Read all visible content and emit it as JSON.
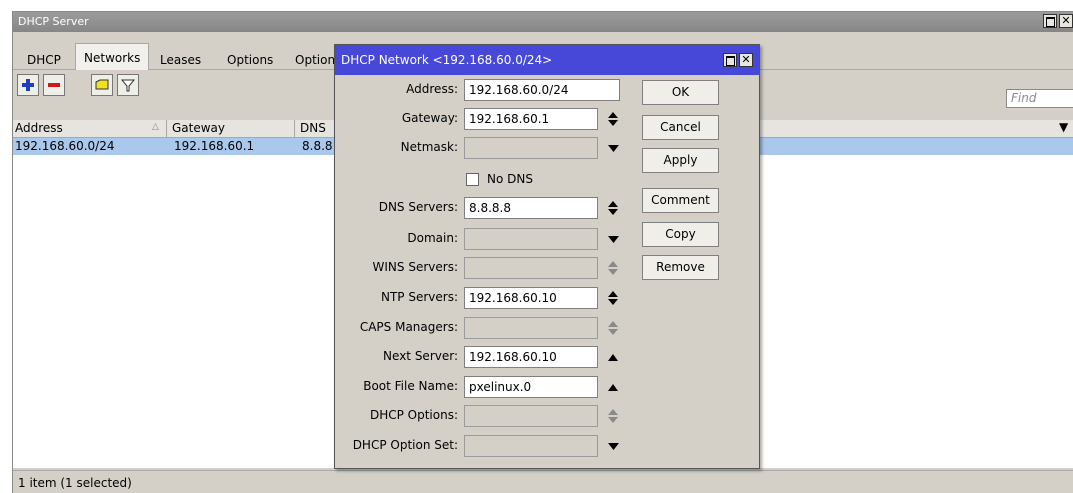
{
  "window": {
    "title": "DHCP Server",
    "tabs": [
      "DHCP",
      "Networks",
      "Leases",
      "Options",
      "Option"
    ],
    "active_tab": "Networks",
    "find_placeholder": "Find",
    "columns": [
      "Address",
      "Gateway",
      "DNS"
    ],
    "rows": [
      {
        "address": "192.168.60.0/24",
        "gateway": "192.168.60.1",
        "dns": "8.8.8"
      }
    ],
    "status": "1 item (1 selected)",
    "toolbar_icons": [
      "add-icon",
      "remove-icon",
      "comment-icon",
      "filter-icon"
    ]
  },
  "dialog": {
    "title": "DHCP Network <192.168.60.0/24>",
    "fields": {
      "address": {
        "label": "Address:",
        "value": "192.168.60.0/24"
      },
      "gateway": {
        "label": "Gateway:",
        "value": "192.168.60.1"
      },
      "netmask": {
        "label": "Netmask:",
        "value": ""
      },
      "no_dns": {
        "label": "No DNS",
        "checked": false
      },
      "dns_servers": {
        "label": "DNS Servers:",
        "value": "8.8.8.8"
      },
      "domain": {
        "label": "Domain:",
        "value": ""
      },
      "wins_servers": {
        "label": "WINS Servers:",
        "value": ""
      },
      "ntp_servers": {
        "label": "NTP Servers:",
        "value": "192.168.60.10"
      },
      "caps_managers": {
        "label": "CAPS Managers:",
        "value": ""
      },
      "next_server": {
        "label": "Next Server:",
        "value": "192.168.60.10"
      },
      "boot_file_name": {
        "label": "Boot File Name:",
        "value": "pxelinux.0"
      },
      "dhcp_options": {
        "label": "DHCP Options:",
        "value": ""
      },
      "dhcp_option_set": {
        "label": "DHCP Option Set:",
        "value": ""
      }
    },
    "buttons": {
      "ok": "OK",
      "cancel": "Cancel",
      "apply": "Apply",
      "comment": "Comment",
      "copy": "Copy",
      "remove": "Remove"
    }
  },
  "colors": {
    "selection": "#a9c8ec",
    "dialog_title": "#4848d8",
    "window_title": "#8e8e8e",
    "add_icon": "#1f3fbf",
    "remove_icon": "#d01818",
    "comment_icon": "#f0e020"
  }
}
